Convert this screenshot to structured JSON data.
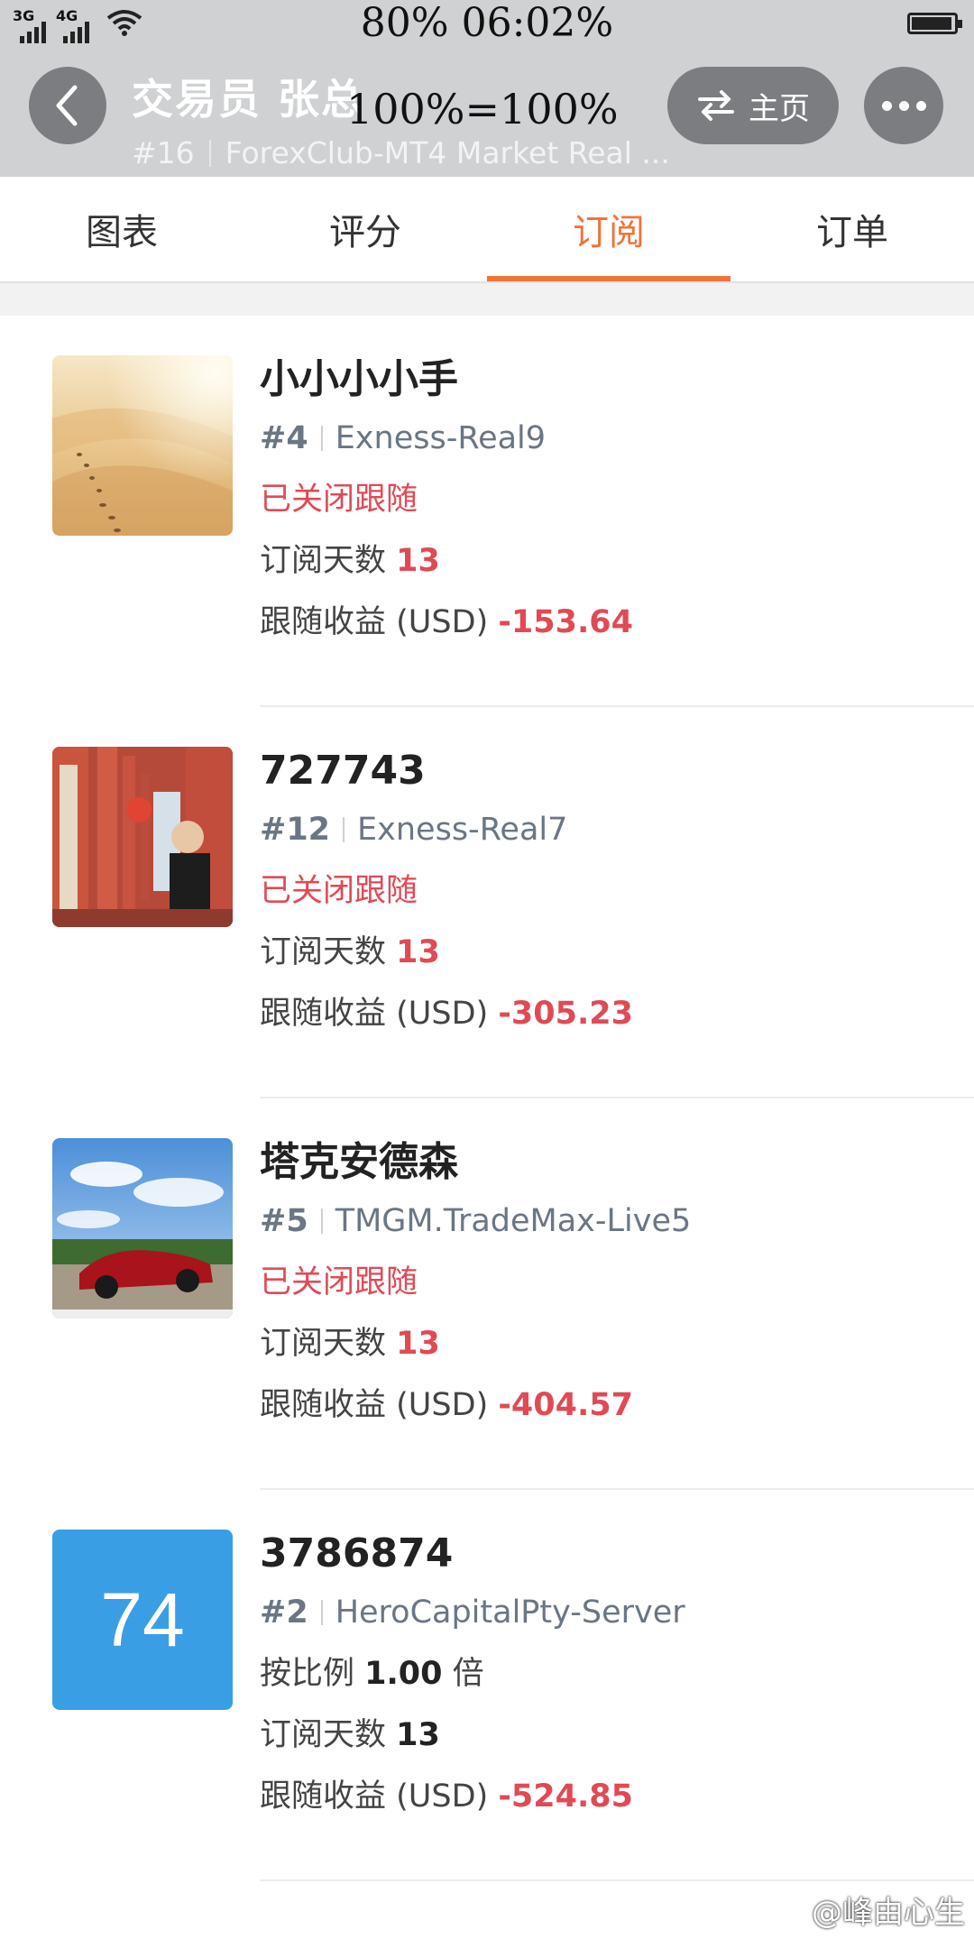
{
  "status_bar": {
    "signal1": "3G",
    "signal2": "4G",
    "center_text": "80% 06:02%"
  },
  "header": {
    "title": "交易员  张总",
    "overlay_text": "100%=100%",
    "rank": "#16",
    "server": "ForexClub-MT4 Market Real ...",
    "home_label": "主页"
  },
  "tabs": [
    {
      "label": "图表"
    },
    {
      "label": "评分"
    },
    {
      "label": "订阅",
      "active": true
    },
    {
      "label": "订单"
    }
  ],
  "labels": {
    "days_label": "订阅天数",
    "profit_label": "跟随收益 (USD)",
    "ratio_prefix": "按比例",
    "ratio_suffix": "倍"
  },
  "items": [
    {
      "name": "小小小小手",
      "rank": "#4",
      "server": "Exness-Real9",
      "status": "已关闭跟随",
      "days": "13",
      "profit": "-153.64",
      "avatar": "desert-photo"
    },
    {
      "name": "727743",
      "rank": "#12",
      "server": "Exness-Real7",
      "status": "已关闭跟随",
      "days": "13",
      "profit": "-305.23",
      "avatar": "temple-photo"
    },
    {
      "name": "塔克安德森",
      "rank": "#5",
      "server": "TMGM.TradeMax-Live5",
      "status": "已关闭跟随",
      "days": "13",
      "profit": "-404.57",
      "avatar": "red-car-photo"
    },
    {
      "name": "3786874",
      "rank": "#2",
      "server": "HeroCapitalPty-Server",
      "ratio": "1.00",
      "days": "13",
      "profit": "-524.85",
      "avatar_text": "74"
    }
  ],
  "watermark": "@峰由心生",
  "colors": {
    "accent": "#f07338",
    "negative": "#e04a55",
    "header_bg": "#cfd1d3",
    "avatar_blue": "#3a9ee4"
  }
}
